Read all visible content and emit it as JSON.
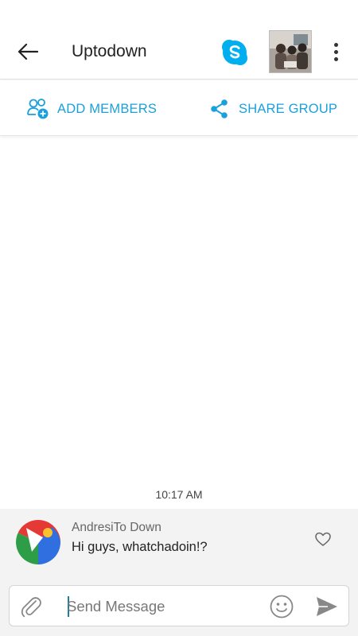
{
  "header": {
    "title": "Uptodown",
    "back_icon": "arrow-left-icon",
    "skype_icon": "skype-logo-icon",
    "avatar": "group-photo",
    "more_icon": "more-vertical-icon"
  },
  "actions": {
    "add_members_label": "ADD MEMBERS",
    "share_group_label": "SHARE GROUP",
    "add_icon": "add-person-icon",
    "share_icon": "share-icon"
  },
  "chat": {
    "timestamp": "10:17 AM",
    "messages": [
      {
        "sender": "AndresiTo Down",
        "text": "Hi guys, whatchadoin!?",
        "avatar_icon": "user-avatar-icon",
        "like_icon": "heart-outline-icon"
      }
    ]
  },
  "composer": {
    "placeholder": "Send Message",
    "value": "",
    "attach_icon": "paperclip-icon",
    "emoji_icon": "smiley-icon",
    "send_icon": "send-icon"
  },
  "colors": {
    "accent": "#1aa0dc",
    "skype": "#00aff0",
    "message_bg": "#f3f3f3"
  }
}
